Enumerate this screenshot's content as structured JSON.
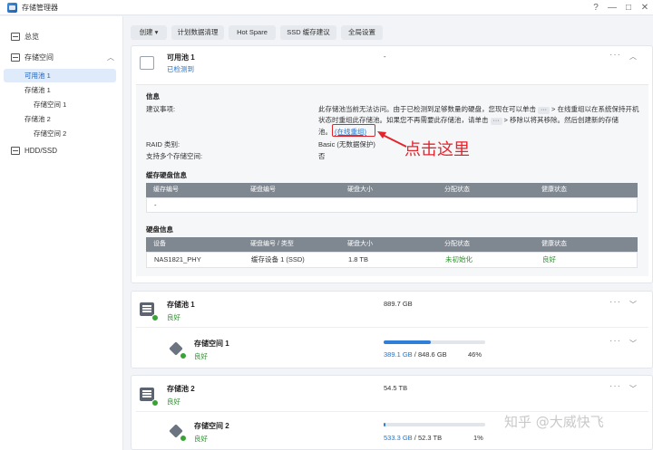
{
  "window": {
    "title": "存储管理器",
    "help": "?",
    "minimize": "—",
    "maximize": "□",
    "close": "✕"
  },
  "sidebar": {
    "overview": "总览",
    "storage": "存储空间",
    "items": [
      "可用池 1",
      "存储池 1",
      "存储空间 1",
      "存储池 2",
      "存储空间 2"
    ],
    "hdd": "HDD/SSD"
  },
  "toolbar": {
    "create": "创建 ▾",
    "schedule": "计划数据清理",
    "hotspare": "Hot Spare",
    "ssd": "SSD 缓存建议",
    "global": "全局设置"
  },
  "available_pool": {
    "title": "可用池 1",
    "status": "已检测到",
    "dash": "-",
    "info_heading": "信息",
    "suggestion_label": "建议事项:",
    "suggestion_line1_a": "此存储池当前无法访问。由于已检测到足够数量的硬盘，您现在可以单击",
    "suggestion_line1_b": "> 在线重组以在系统保持开机",
    "suggestion_line2_a": "状态时重组此存储池。如果您不再需要此存储池，请单击",
    "suggestion_line2_b": "> 移除以将其移除。然后创建新的存储",
    "suggestion_line3": "池。",
    "online_link": "(在线重组)",
    "inline_btn": "···",
    "raid_label": "RAID 类别:",
    "raid_value": "Basic (无数据保护)",
    "multi_label": "支持多个存储空间:",
    "multi_value": "否",
    "cache_heading": "缓存硬盘信息",
    "cache_headers": [
      "缓存编号",
      "硬盘编号",
      "硬盘大小",
      "分配状态",
      "健康状态"
    ],
    "cache_row": "-",
    "disk_heading": "硬盘信息",
    "disk_headers": [
      "设备",
      "硬盘编号 / 类型",
      "硬盘大小",
      "分配状态",
      "健康状态"
    ],
    "disk_row": {
      "device": "NAS1821_PHY",
      "id": "缓存设备 1 (SSD)",
      "size": "1.8 TB",
      "alloc": "未初始化",
      "health": "良好"
    }
  },
  "pool1": {
    "title": "存储池 1",
    "status": "良好",
    "size": "889.7 GB"
  },
  "volume1": {
    "title": "存储空间 1",
    "status": "良好",
    "used": "389.1 GB",
    "total": "/ 848.6 GB",
    "percent": "46%",
    "fill": 0.46
  },
  "pool2": {
    "title": "存储池 2",
    "status": "良好",
    "size": "54.5 TB"
  },
  "volume2": {
    "title": "存储空间 2",
    "status": "良好",
    "used": "533.3 GB",
    "total": "/ 52.3 TB",
    "percent": "1%",
    "fill": 0.01
  },
  "annotation": "点击这里",
  "watermark": "知乎 @大威快飞",
  "colors": {
    "accent": "#1d74d0",
    "ok": "#2e8f2e",
    "annotation": "#e3242b"
  }
}
